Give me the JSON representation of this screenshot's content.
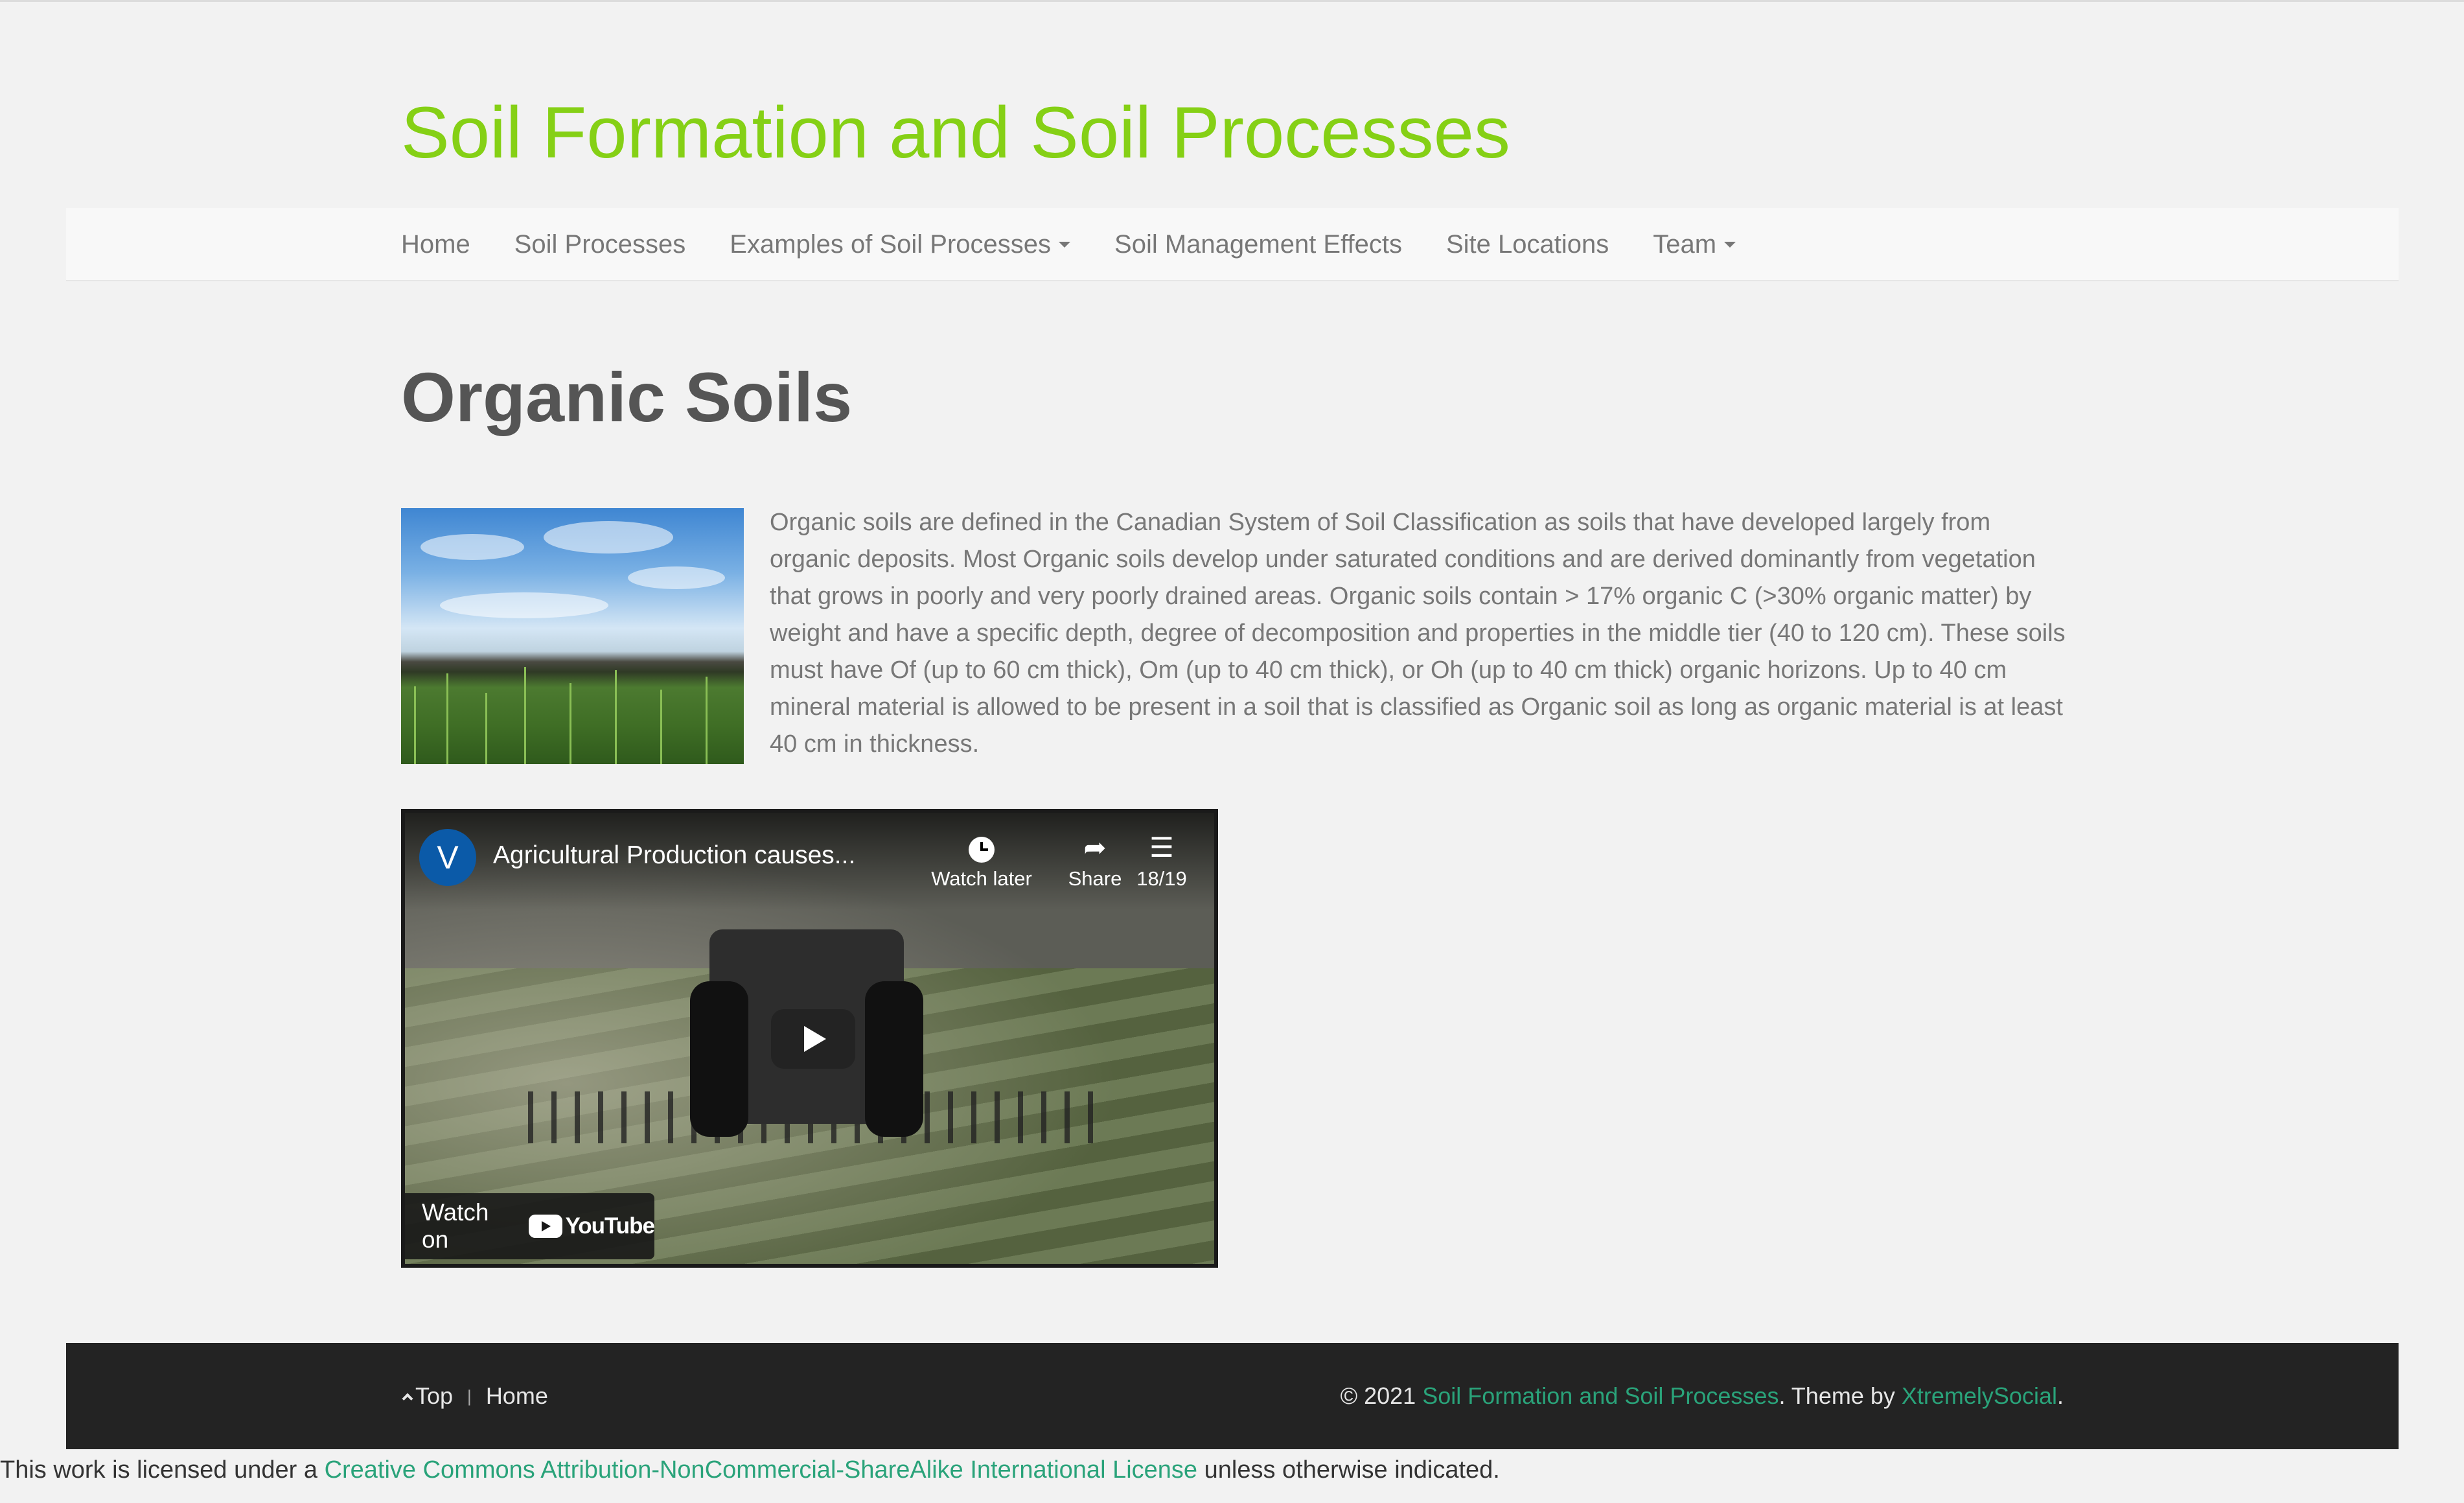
{
  "site": {
    "title": "Soil Formation and Soil Processes"
  },
  "nav": {
    "items": [
      {
        "label": "Home"
      },
      {
        "label": "Soil Processes"
      },
      {
        "label": "Examples of Soil Processes",
        "dropdown": true
      },
      {
        "label": "Soil Management Effects"
      },
      {
        "label": "Site Locations"
      },
      {
        "label": "Team",
        "dropdown": true
      }
    ]
  },
  "page": {
    "title": "Organic Soils",
    "body": "Organic soils are defined in the Canadian System of Soil Classification as soils that have developed largely from organic deposits. Most Organic soils develop under saturated conditions and are derived dominantly from vegetation that grows in poorly and very poorly drained areas. Organic soils contain > 17% organic C (>30% organic matter) by weight and have a specific depth, degree of decomposition and properties in the middle tier (40 to 120 cm). These soils must have Of (up to 60 cm thick), Om (up to 40 cm thick), or Oh (up to 40 cm thick) organic horizons. Up to 40 cm mineral material is allowed to be present in a soil that is classified as Organic soil as long as organic material is at least 40 cm in thickness."
  },
  "video": {
    "channel_initial": "V",
    "title": "Agricultural Production causes...",
    "watch_later": "Watch later",
    "share": "Share",
    "playlist_position": "18/19",
    "watch_on": "Watch on",
    "youtube": "YouTube"
  },
  "footer": {
    "top_label": "Top",
    "home_label": "Home",
    "separator": "|",
    "copyright_prefix": "© 2021",
    "site_link": "Soil Formation and Soil Processes",
    "theme_prefix": ". Theme by",
    "theme_link": "XtremelySocial",
    "theme_suffix": "."
  },
  "license": {
    "prefix": "This work is licensed under a",
    "link": "Creative Commons Attribution-NonCommercial-ShareAlike International License",
    "suffix": "unless otherwise indicated."
  },
  "colors": {
    "title_green": "#85d015",
    "link_green": "#2aa37a",
    "footer_bg": "#232323",
    "page_bg": "#f2f2f2"
  }
}
